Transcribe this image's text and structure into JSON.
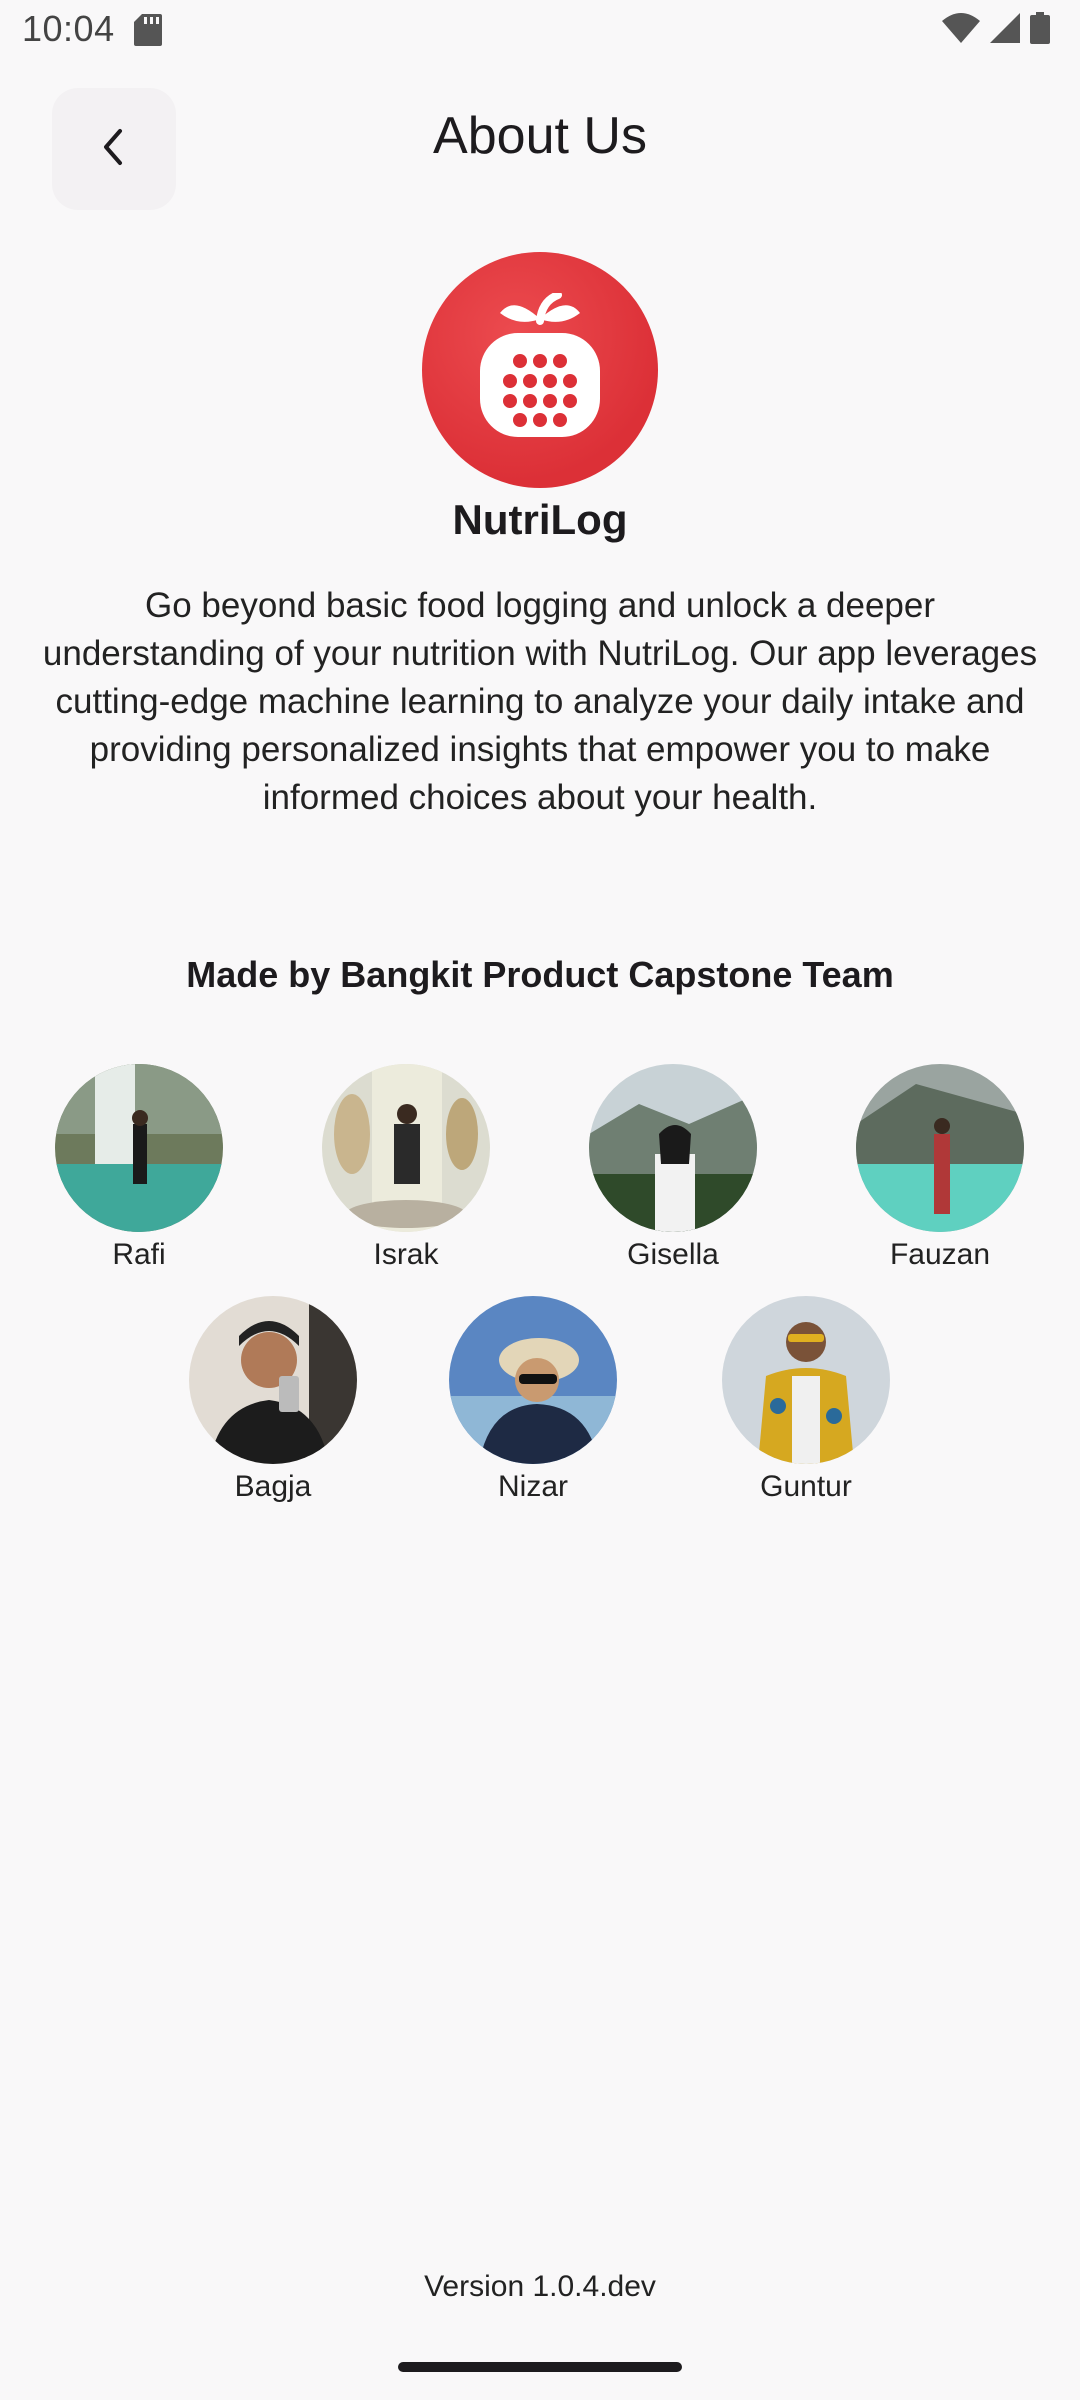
{
  "status_bar": {
    "time": "10:04",
    "icons": [
      "sd-card-icon",
      "wifi-icon",
      "signal-icon",
      "battery-icon"
    ]
  },
  "header": {
    "title": "About Us",
    "back_icon": "chevron-left-icon"
  },
  "app": {
    "name": "NutriLog",
    "logo_icon": "apple-calculator-icon",
    "brand_color": "#dc3037",
    "description": "Go beyond basic food logging and unlock a deeper understanding of your nutrition with NutriLog. Our app leverages cutting-edge machine learning to analyze your daily intake and providing personalized insights that empower you to make informed choices about your health."
  },
  "team": {
    "heading": "Made by Bangkit Product Capstone Team",
    "members": [
      {
        "name": "Rafi"
      },
      {
        "name": "Israk"
      },
      {
        "name": "Gisella"
      },
      {
        "name": "Fauzan"
      },
      {
        "name": "Bagja"
      },
      {
        "name": "Nizar"
      },
      {
        "name": "Guntur"
      }
    ]
  },
  "footer": {
    "version": "Version 1.0.4.dev"
  }
}
